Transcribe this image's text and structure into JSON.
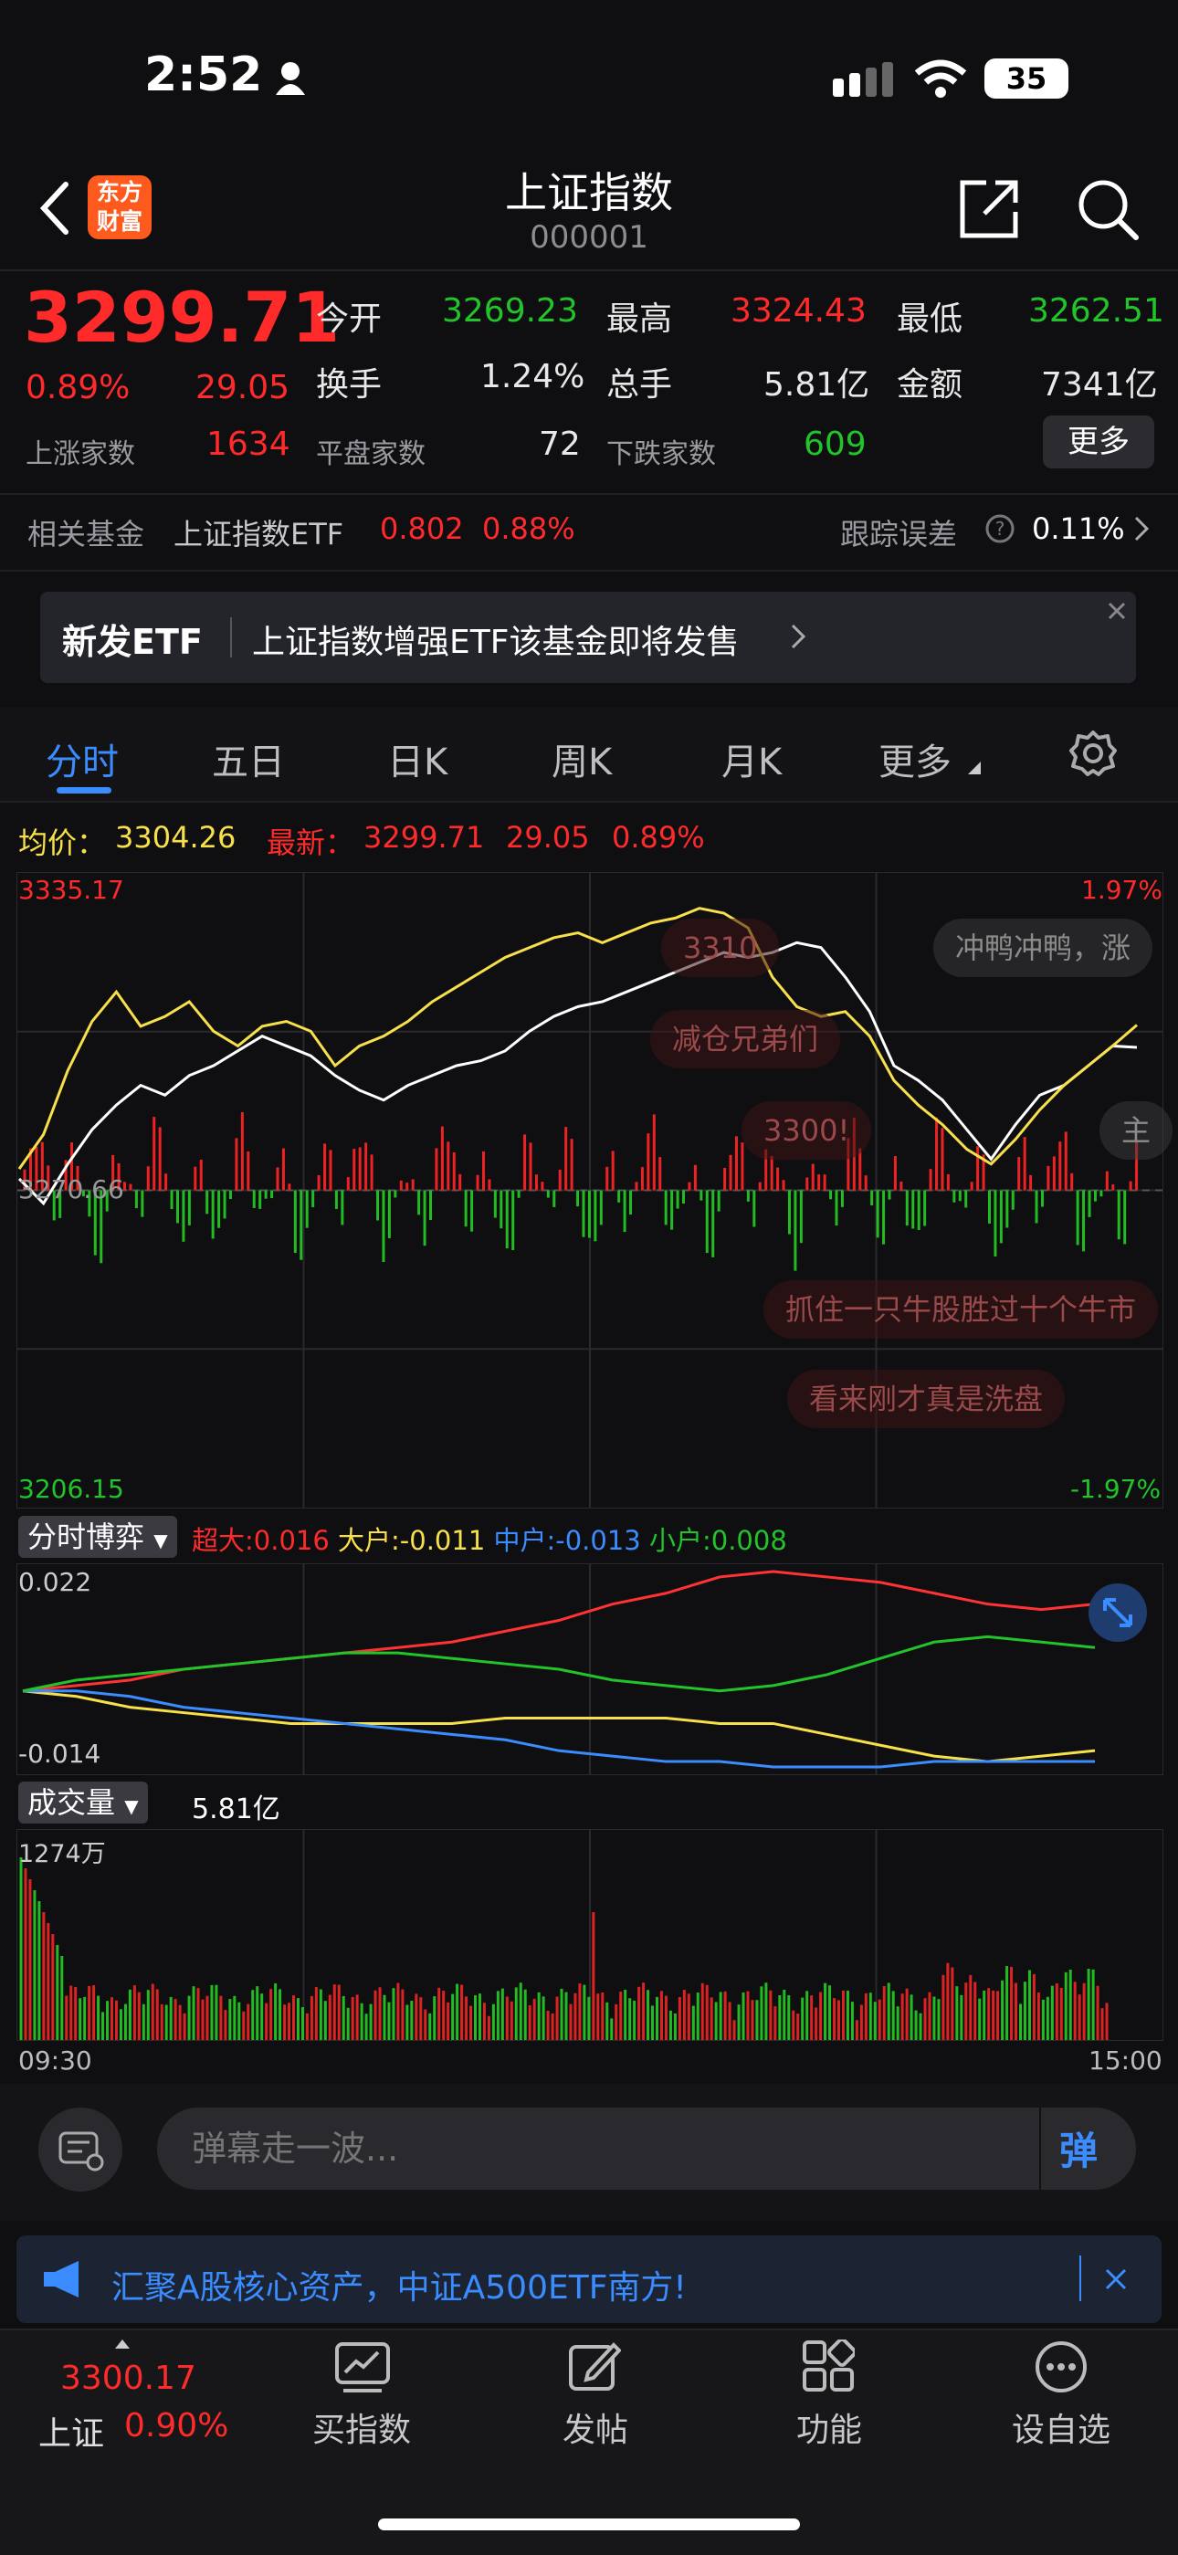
{
  "status_bar": {
    "time": "2:52",
    "battery": "35"
  },
  "header": {
    "logo": "东方\n财富",
    "title": "上证指数",
    "code": "000001"
  },
  "quote": {
    "price": "3299.71",
    "change_pct": "0.89%",
    "change": "29.05",
    "open_label": "今开",
    "open": "3269.23",
    "high_label": "最高",
    "high": "3324.43",
    "low_label": "最低",
    "low": "3262.51",
    "turnover_label": "换手",
    "turnover": "1.24%",
    "volume_label": "总手",
    "volume": "5.81亿",
    "amount_label": "金额",
    "amount": "7341亿",
    "up_label": "上涨家数",
    "up_count": "1634",
    "flat_label": "平盘家数",
    "flat_count": "72",
    "down_label": "下跌家数",
    "down_count": "609",
    "more": "更多"
  },
  "fund_row": {
    "label": "相关基金",
    "name": "上证指数ETF",
    "price": "0.802",
    "pct": "0.88%",
    "track_label": "跟踪误差",
    "track_value": "0.11%"
  },
  "banner": {
    "tag": "新发ETF",
    "text": "上证指数增强ETF该基金即将发售"
  },
  "tabs": [
    "分时",
    "五日",
    "日K",
    "周K",
    "月K",
    "更多"
  ],
  "info_line": {
    "avg_label": "均价：",
    "avg": "3304.26",
    "latest_label": "最新：",
    "latest": "3299.71",
    "change": "29.05",
    "pct": "0.89%"
  },
  "chart_data": [
    {
      "type": "line",
      "name": "intraday",
      "ylim": [
        3206.15,
        3335.17
      ],
      "y_top_label": "3335.17",
      "y_bottom_label": "3206.15",
      "y_mid_label": "3270.66",
      "pct_top": "1.97%",
      "pct_bottom": "-1.97%",
      "series": [
        {
          "name": "price",
          "color": "#ffffff",
          "values": [
            3273,
            3268,
            3276,
            3283,
            3288,
            3292,
            3290,
            3294,
            3296,
            3299,
            3302,
            3300,
            3298,
            3294,
            3291,
            3289,
            3292,
            3294,
            3296,
            3297,
            3299,
            3303,
            3306,
            3308,
            3309,
            3311,
            3313,
            3315,
            3317,
            3319,
            3318,
            3319,
            3321,
            3320,
            3314,
            3307,
            3296,
            3293,
            3289,
            3283,
            3277,
            3284,
            3290,
            3292,
            3296,
            3300,
            3299.71
          ]
        },
        {
          "name": "avg",
          "color": "#f7e04a",
          "values": [
            3275,
            3282,
            3295,
            3305,
            3311,
            3304,
            3306,
            3309,
            3303,
            3300,
            3304,
            3305,
            3303,
            3296,
            3300,
            3302,
            3305,
            3309,
            3312,
            3315,
            3318,
            3320,
            3322,
            3323,
            3321,
            3323,
            3325,
            3326,
            3328,
            3327,
            3324,
            3314,
            3308,
            3306,
            3307,
            3302,
            3293,
            3288,
            3284,
            3279,
            3276,
            3281,
            3287,
            3292,
            3296,
            3300,
            3304.26
          ]
        }
      ]
    },
    {
      "type": "line",
      "name": "分时博弈",
      "legend": [
        {
          "label": "超大:0.016",
          "color": "#ff3333"
        },
        {
          "label": "大户:-0.011",
          "color": "#f7e04a"
        },
        {
          "label": "中户:-0.013",
          "color": "#3a8cff"
        },
        {
          "label": "小户:0.008",
          "color": "#22c42a"
        }
      ],
      "ylim": [
        -0.014,
        0.022
      ],
      "y_top_label": "0.022",
      "y_bottom_label": "-0.014",
      "series": [
        {
          "name": "超大",
          "color": "#ff3333",
          "values": [
            0,
            0.001,
            0.002,
            0.004,
            0.005,
            0.006,
            0.007,
            0.008,
            0.009,
            0.011,
            0.013,
            0.016,
            0.018,
            0.021,
            0.022,
            0.021,
            0.02,
            0.018,
            0.016,
            0.015,
            0.016
          ]
        },
        {
          "name": "大户",
          "color": "#f7e04a",
          "values": [
            0,
            -0.001,
            -0.003,
            -0.004,
            -0.005,
            -0.006,
            -0.006,
            -0.006,
            -0.006,
            -0.005,
            -0.005,
            -0.005,
            -0.005,
            -0.006,
            -0.006,
            -0.008,
            -0.01,
            -0.012,
            -0.013,
            -0.012,
            -0.011
          ]
        },
        {
          "name": "中户",
          "color": "#3a8cff",
          "values": [
            0,
            0,
            -0.001,
            -0.003,
            -0.004,
            -0.005,
            -0.006,
            -0.007,
            -0.008,
            -0.009,
            -0.011,
            -0.012,
            -0.013,
            -0.013,
            -0.014,
            -0.014,
            -0.014,
            -0.013,
            -0.013,
            -0.013,
            -0.013
          ]
        },
        {
          "name": "小户",
          "color": "#22c42a",
          "values": [
            0,
            0.002,
            0.003,
            0.004,
            0.005,
            0.006,
            0.007,
            0.007,
            0.006,
            0.005,
            0.004,
            0.002,
            0.001,
            0.0,
            0.001,
            0.003,
            0.006,
            0.009,
            0.01,
            0.009,
            0.008
          ]
        }
      ]
    },
    {
      "type": "bar",
      "name": "成交量",
      "total": "5.81亿",
      "max_label": "1274万",
      "x_start": "09:30",
      "x_end": "15:00"
    }
  ],
  "game_dropdown": "分时博弈",
  "volume_dropdown": "成交量",
  "danmu": [
    {
      "text": "3310"
    },
    {
      "text": "冲鸭冲鸭，涨"
    },
    {
      "text": "减仓兄弟们"
    },
    {
      "text": "3300!"
    },
    {
      "text": "主"
    },
    {
      "text": "抓住一只牛股胜过十个牛市"
    },
    {
      "text": "看来刚才真是洗盘"
    }
  ],
  "comment": {
    "placeholder": "弹幕走一波...",
    "send": "弹"
  },
  "ad": {
    "text": "汇聚A股核心资产，中证A500ETF南方!"
  },
  "bottom_nav": {
    "index_price": "3300.17",
    "index_name": "上证",
    "index_pct": "0.90%",
    "items": [
      "买指数",
      "发帖",
      "功能",
      "设自选"
    ]
  }
}
